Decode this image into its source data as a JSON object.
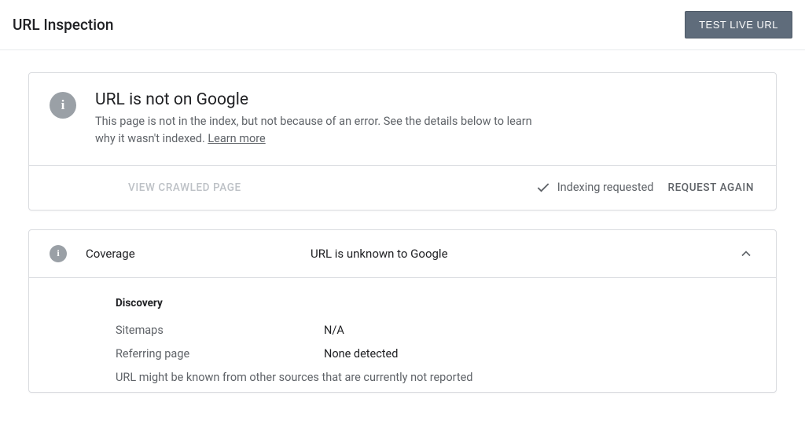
{
  "header": {
    "title": "URL Inspection",
    "test_live_btn": "TEST LIVE URL"
  },
  "status_card": {
    "title": "URL is not on Google",
    "desc_line1": "This page is not in the index, but not because of an error. See the details below to learn",
    "desc_line2_prefix": "why it wasn't indexed. ",
    "learn_more": "Learn more",
    "view_crawled": "VIEW CRAWLED PAGE",
    "indexing_status": "Indexing requested",
    "request_again": "REQUEST AGAIN"
  },
  "coverage": {
    "label": "Coverage",
    "value": "URL is unknown to Google",
    "discovery": {
      "title": "Discovery",
      "sitemaps": {
        "label": "Sitemaps",
        "value": "N/A"
      },
      "referring": {
        "label": "Referring page",
        "value": "None detected"
      },
      "note": "URL might be known from other sources that are currently not reported"
    }
  }
}
